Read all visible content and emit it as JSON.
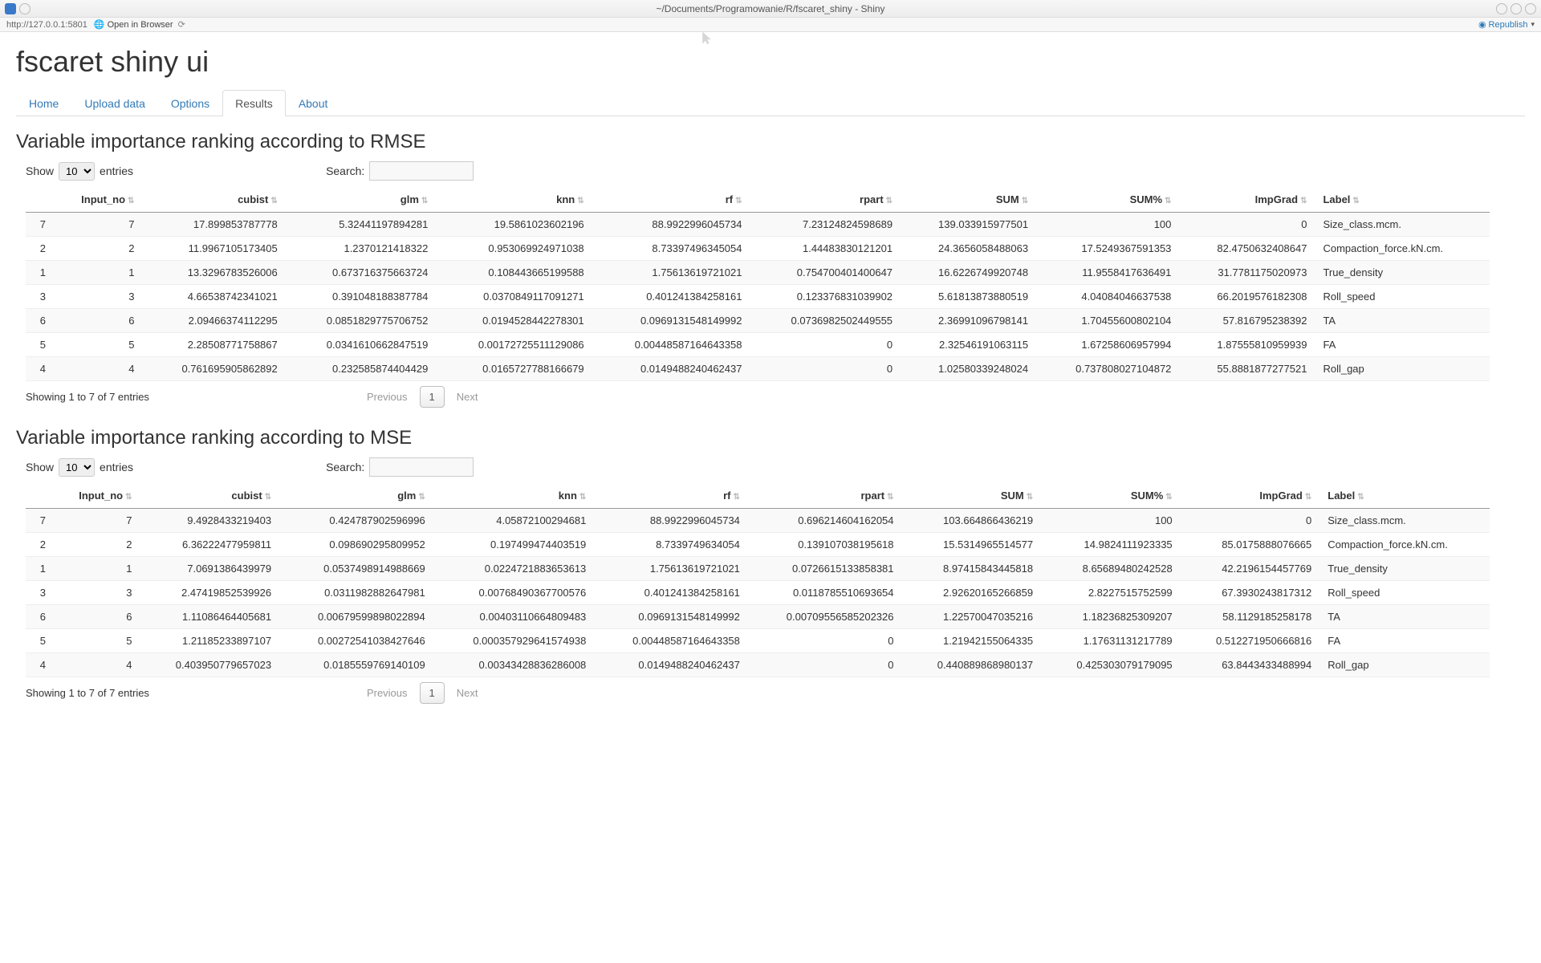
{
  "window": {
    "title": "~/Documents/Programowanie/R/fscaret_shiny - Shiny",
    "url": "http://127.0.0.1:5801",
    "open_in_browser": "Open in Browser",
    "republish": "Republish"
  },
  "app": {
    "title": "fscaret shiny ui"
  },
  "tabs": {
    "home": "Home",
    "upload": "Upload data",
    "options": "Options",
    "results": "Results",
    "about": "About"
  },
  "dt_common": {
    "show": "Show",
    "entries": "entries",
    "search": "Search:",
    "previous": "Previous",
    "next": "Next",
    "page1": "1",
    "length_value": "10",
    "info": "Showing 1 to 7 of 7 entries"
  },
  "section1": {
    "title": "Variable importance ranking according to RMSE",
    "columns": [
      "",
      "Input_no",
      "cubist",
      "glm",
      "knn",
      "rf",
      "rpart",
      "SUM",
      "SUM%",
      "ImpGrad",
      "Label"
    ],
    "rows": [
      {
        "idx": "7",
        "input_no": "7",
        "cubist": "17.899853787778",
        "glm": "5.32441197894281",
        "knn": "19.5861023602196",
        "rf": "88.9922996045734",
        "rpart": "7.23124824598689",
        "sum": "139.033915977501",
        "sumpct": "100",
        "impgrad": "0",
        "label": "Size_class.mcm."
      },
      {
        "idx": "2",
        "input_no": "2",
        "cubist": "11.9967105173405",
        "glm": "1.2370121418322",
        "knn": "0.953069924971038",
        "rf": "8.73397496345054",
        "rpart": "1.44483830121201",
        "sum": "24.3656058488063",
        "sumpct": "17.5249367591353",
        "impgrad": "82.4750632408647",
        "label": "Compaction_force.kN.cm."
      },
      {
        "idx": "1",
        "input_no": "1",
        "cubist": "13.3296783526006",
        "glm": "0.673716375663724",
        "knn": "0.108443665199588",
        "rf": "1.75613619721021",
        "rpart": "0.754700401400647",
        "sum": "16.6226749920748",
        "sumpct": "11.9558417636491",
        "impgrad": "31.7781175020973",
        "label": "True_density"
      },
      {
        "idx": "3",
        "input_no": "3",
        "cubist": "4.66538742341021",
        "glm": "0.391048188387784",
        "knn": "0.0370849117091271",
        "rf": "0.401241384258161",
        "rpart": "0.123376831039902",
        "sum": "5.61813873880519",
        "sumpct": "4.04084046637538",
        "impgrad": "66.2019576182308",
        "label": "Roll_speed"
      },
      {
        "idx": "6",
        "input_no": "6",
        "cubist": "2.09466374112295",
        "glm": "0.0851829775706752",
        "knn": "0.0194528442278301",
        "rf": "0.0969131548149992",
        "rpart": "0.0736982502449555",
        "sum": "2.36991096798141",
        "sumpct": "1.70455600802104",
        "impgrad": "57.816795238392",
        "label": "TA"
      },
      {
        "idx": "5",
        "input_no": "5",
        "cubist": "2.28508771758867",
        "glm": "0.0341610662847519",
        "knn": "0.00172725511129086",
        "rf": "0.00448587164643358",
        "rpart": "0",
        "sum": "2.32546191063115",
        "sumpct": "1.67258606957994",
        "impgrad": "1.87555810959939",
        "label": "FA"
      },
      {
        "idx": "4",
        "input_no": "4",
        "cubist": "0.761695905862892",
        "glm": "0.232585874404429",
        "knn": "0.0165727788166679",
        "rf": "0.0149488240462437",
        "rpart": "0",
        "sum": "1.02580339248024",
        "sumpct": "0.737808027104872",
        "impgrad": "55.8881877277521",
        "label": "Roll_gap"
      }
    ]
  },
  "section2": {
    "title": "Variable importance ranking according to MSE",
    "columns": [
      "",
      "Input_no",
      "cubist",
      "glm",
      "knn",
      "rf",
      "rpart",
      "SUM",
      "SUM%",
      "ImpGrad",
      "Label"
    ],
    "rows": [
      {
        "idx": "7",
        "input_no": "7",
        "cubist": "9.4928433219403",
        "glm": "0.424787902596996",
        "knn": "4.05872100294681",
        "rf": "88.9922996045734",
        "rpart": "0.696214604162054",
        "sum": "103.664866436219",
        "sumpct": "100",
        "impgrad": "0",
        "label": "Size_class.mcm."
      },
      {
        "idx": "2",
        "input_no": "2",
        "cubist": "6.36222477959811",
        "glm": "0.098690295809952",
        "knn": "0.197499474403519",
        "rf": "8.7339749634054",
        "rpart": "0.139107038195618",
        "sum": "15.5314965514577",
        "sumpct": "14.9824111923335",
        "impgrad": "85.0175888076665",
        "label": "Compaction_force.kN.cm."
      },
      {
        "idx": "1",
        "input_no": "1",
        "cubist": "7.0691386439979",
        "glm": "0.0537498914988669",
        "knn": "0.0224721883653613",
        "rf": "1.75613619721021",
        "rpart": "0.0726615133858381",
        "sum": "8.97415843445818",
        "sumpct": "8.65689480242528",
        "impgrad": "42.2196154457769",
        "label": "True_density"
      },
      {
        "idx": "3",
        "input_no": "3",
        "cubist": "2.47419852539926",
        "glm": "0.0311982882647981",
        "knn": "0.00768490367700576",
        "rf": "0.401241384258161",
        "rpart": "0.0118785510693654",
        "sum": "2.92620165266859",
        "sumpct": "2.8227515752599",
        "impgrad": "67.3930243817312",
        "label": "Roll_speed"
      },
      {
        "idx": "6",
        "input_no": "6",
        "cubist": "1.11086464405681",
        "glm": "0.00679599898022894",
        "knn": "0.00403110664809483",
        "rf": "0.0969131548149992",
        "rpart": "0.00709556585202326",
        "sum": "1.22570047035216",
        "sumpct": "1.18236825309207",
        "impgrad": "58.1129185258178",
        "label": "TA"
      },
      {
        "idx": "5",
        "input_no": "5",
        "cubist": "1.21185233897107",
        "glm": "0.00272541038427646",
        "knn": "0.000357929641574938",
        "rf": "0.00448587164643358",
        "rpart": "0",
        "sum": "1.21942155064335",
        "sumpct": "1.17631131217789",
        "impgrad": "0.512271950666816",
        "label": "FA"
      },
      {
        "idx": "4",
        "input_no": "4",
        "cubist": "0.403950779657023",
        "glm": "0.0185559769140109",
        "knn": "0.00343428836286008",
        "rf": "0.0149488240462437",
        "rpart": "0",
        "sum": "0.440889868980137",
        "sumpct": "0.425303079179095",
        "impgrad": "63.8443433488994",
        "label": "Roll_gap"
      }
    ]
  }
}
